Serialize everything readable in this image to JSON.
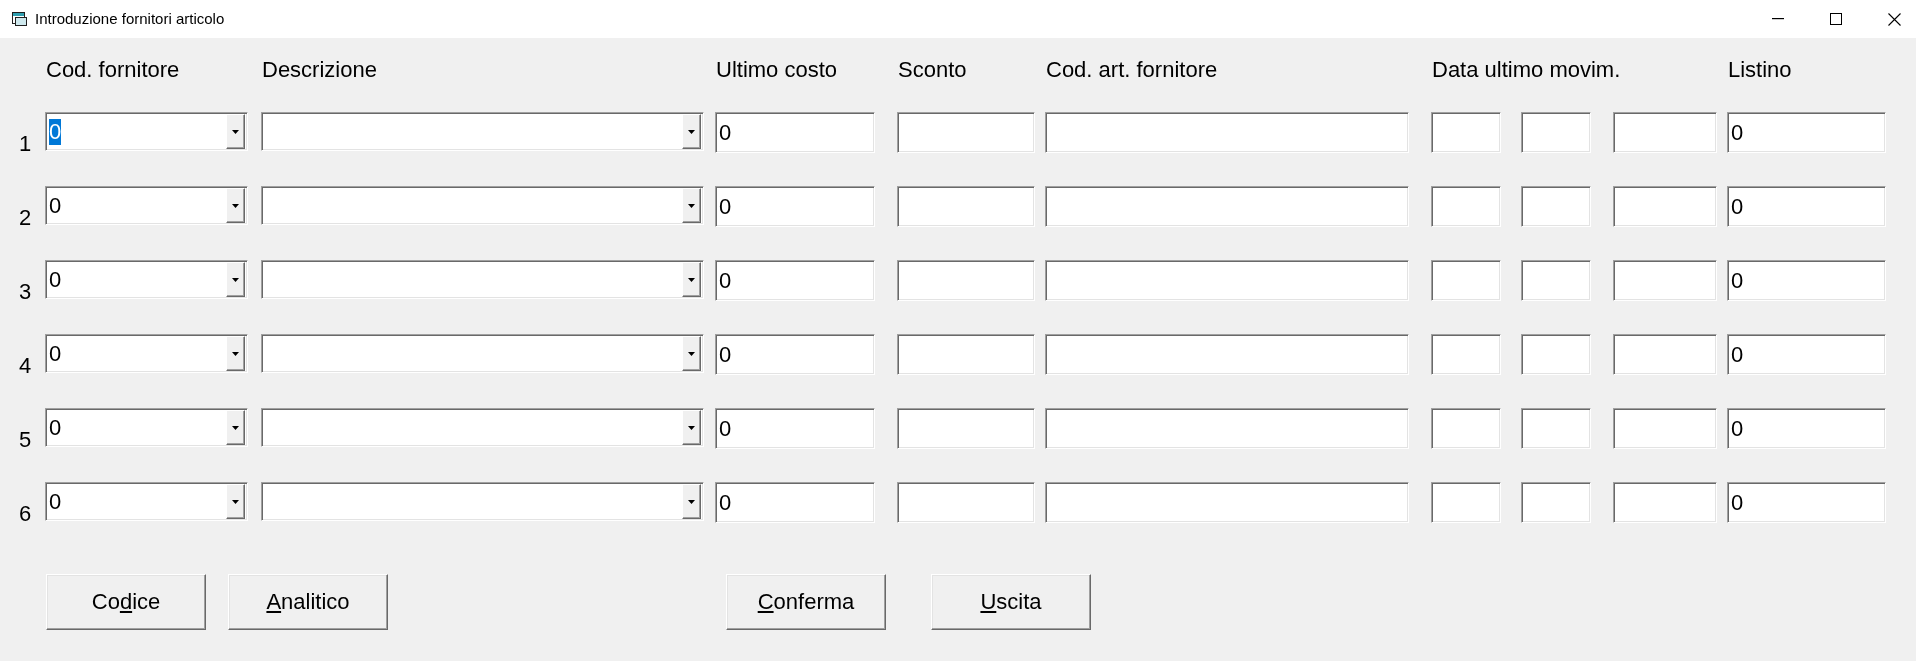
{
  "window": {
    "title": "Introduzione fornitori articolo"
  },
  "columns": [
    {
      "label": "Cod. fornitore"
    },
    {
      "label": "Descrizione"
    },
    {
      "label": "Ultimo costo"
    },
    {
      "label": "Sconto"
    },
    {
      "label": "Cod. art. fornitore"
    },
    {
      "label": "Data ultimo movim."
    },
    {
      "label": "Listino"
    }
  ],
  "rows": [
    {
      "number": "1",
      "fields": [
        {
          "kind": "combo",
          "value": "0",
          "text_selected": true
        },
        {
          "kind": "combo"
        },
        {
          "kind": "text",
          "value": "0",
          "text_selected": false
        },
        {
          "kind": "text"
        },
        {
          "kind": "text"
        },
        {
          "kind": "text"
        },
        {
          "kind": "text"
        },
        {
          "kind": "text"
        },
        {
          "kind": "text",
          "value": "0",
          "text_selected": false
        }
      ]
    },
    {
      "number": "2",
      "fields": [
        {
          "kind": "combo",
          "value": "0",
          "text_selected": false
        },
        {
          "kind": "combo"
        },
        {
          "kind": "text",
          "value": "0",
          "text_selected": false
        },
        {
          "kind": "text"
        },
        {
          "kind": "text"
        },
        {
          "kind": "text"
        },
        {
          "kind": "text"
        },
        {
          "kind": "text"
        },
        {
          "kind": "text",
          "value": "0",
          "text_selected": false
        }
      ]
    },
    {
      "number": "3",
      "fields": [
        {
          "kind": "combo",
          "value": "0",
          "text_selected": false
        },
        {
          "kind": "combo"
        },
        {
          "kind": "text",
          "value": "0",
          "text_selected": false
        },
        {
          "kind": "text"
        },
        {
          "kind": "text"
        },
        {
          "kind": "text"
        },
        {
          "kind": "text"
        },
        {
          "kind": "text"
        },
        {
          "kind": "text",
          "value": "0",
          "text_selected": false
        }
      ]
    },
    {
      "number": "4",
      "fields": [
        {
          "kind": "combo",
          "value": "0",
          "text_selected": false
        },
        {
          "kind": "combo"
        },
        {
          "kind": "text",
          "value": "0",
          "text_selected": false
        },
        {
          "kind": "text"
        },
        {
          "kind": "text"
        },
        {
          "kind": "text"
        },
        {
          "kind": "text"
        },
        {
          "kind": "text"
        },
        {
          "kind": "text",
          "value": "0",
          "text_selected": false
        }
      ]
    },
    {
      "number": "5",
      "fields": [
        {
          "kind": "combo",
          "value": "0",
          "text_selected": false
        },
        {
          "kind": "combo"
        },
        {
          "kind": "text",
          "value": "0",
          "text_selected": false
        },
        {
          "kind": "text"
        },
        {
          "kind": "text"
        },
        {
          "kind": "text"
        },
        {
          "kind": "text"
        },
        {
          "kind": "text"
        },
        {
          "kind": "text",
          "value": "0",
          "text_selected": false
        }
      ]
    },
    {
      "number": "6",
      "fields": [
        {
          "kind": "combo",
          "value": "0",
          "text_selected": false
        },
        {
          "kind": "combo"
        },
        {
          "kind": "text",
          "value": "0",
          "text_selected": false
        },
        {
          "kind": "text"
        },
        {
          "kind": "text"
        },
        {
          "kind": "text"
        },
        {
          "kind": "text"
        },
        {
          "kind": "text"
        },
        {
          "kind": "text",
          "value": "0",
          "text_selected": false
        }
      ]
    }
  ],
  "buttons": [
    {
      "label_start": "Co",
      "hotkey": "d",
      "label_end": "ice"
    },
    {
      "hotkey": "A",
      "label_end": "nalitico"
    },
    {
      "hotkey": "C",
      "label_end": "onferma"
    },
    {
      "hotkey": "U",
      "label_end": "scita"
    }
  ]
}
